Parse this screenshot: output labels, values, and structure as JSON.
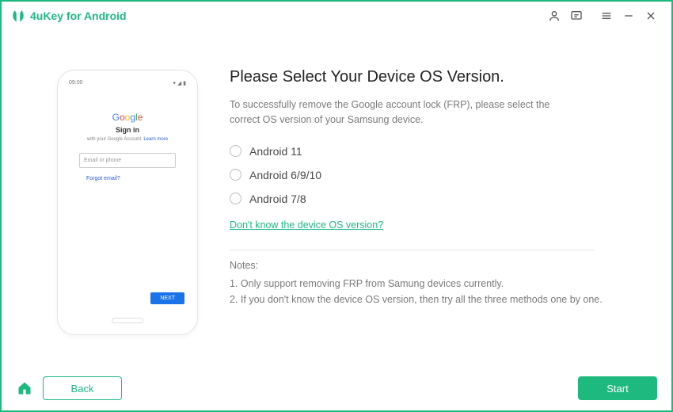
{
  "app": {
    "title": "4uKey for Android"
  },
  "phone": {
    "time": "09:00",
    "google": "Google",
    "signin": "Sign in",
    "subtext_a": "with your Google Account.",
    "subtext_b": "Learn more",
    "placeholder": "Email or phone",
    "forgot": "Forgot email?",
    "next": "NEXT"
  },
  "main": {
    "heading": "Please Select Your Device OS Version.",
    "description": "To successfully remove the Google account lock (FRP), please select the correct OS version of your Samsung device.",
    "options": [
      "Android 11",
      "Android 6/9/10",
      "Android 7/8"
    ],
    "help_link": "Don't know the device OS version?",
    "notes_heading": "Notes:",
    "notes": [
      "1. Only support removing FRP from Samung devices currently.",
      "2. If you don't know the device OS version, then try all the three methods one by one."
    ]
  },
  "footer": {
    "back": "Back",
    "start": "Start"
  }
}
